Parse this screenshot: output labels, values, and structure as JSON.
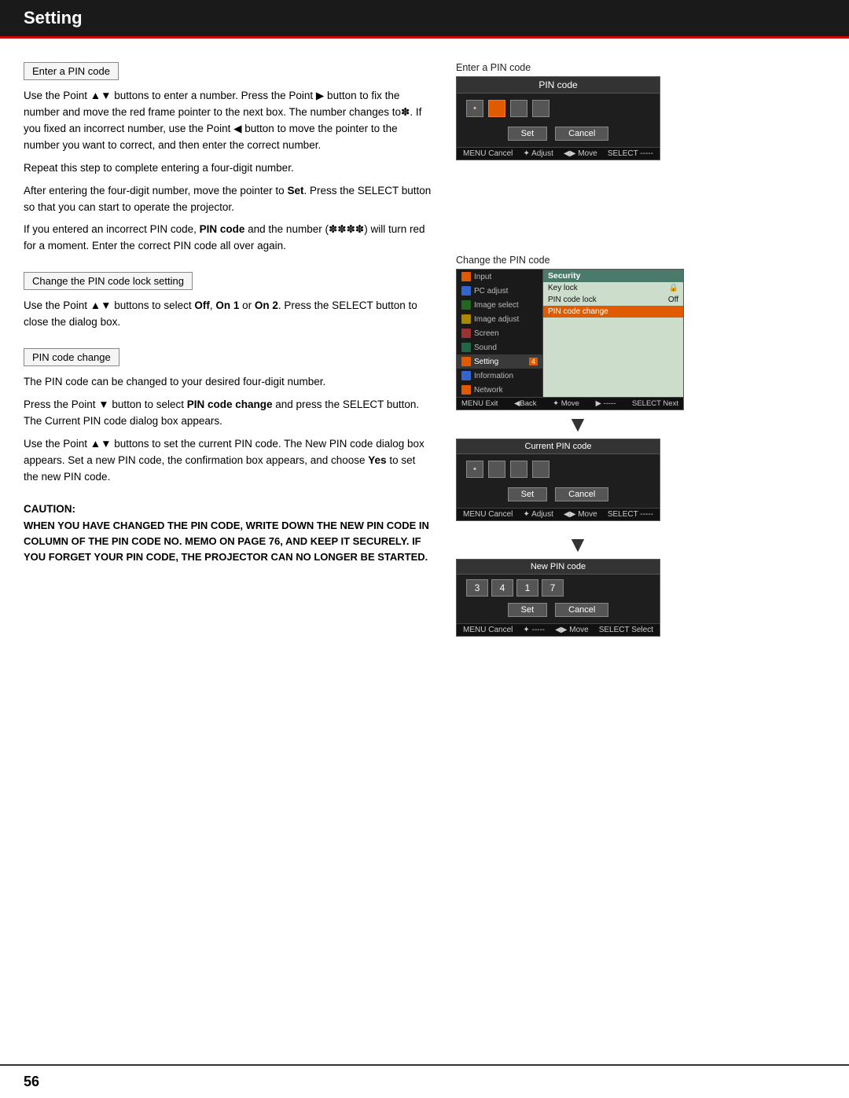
{
  "header": {
    "title": "Setting",
    "bg_color": "#1a1a1a",
    "accent_color": "#cc0000"
  },
  "page_number": "56",
  "sections": {
    "enter_pin": {
      "label": "Enter a PIN code",
      "paragraphs": [
        "Use the Point ▲▼ buttons to enter a number. Press the Point ▶ button to fix the number and move the red frame pointer to the next box. The number changes to✽. If you fixed an incorrect number, use the Point ◀ button to move the pointer to the number you want to correct, and then enter the correct number.",
        "Repeat this step to complete entering a four-digit number.",
        "After entering the four-digit number, move the pointer to Set. Press the SELECT button so that you can start to operate the projector.",
        "If you entered an incorrect PIN code, PIN code and the number (✽✽✽✽) will turn red for a moment. Enter the correct PIN code all over again."
      ]
    },
    "change_pin_lock": {
      "label": "Change the PIN code lock setting",
      "paragraphs": [
        "Use the Point ▲▼ buttons to select Off, On 1 or On 2. Press the SELECT button to close the dialog box."
      ]
    },
    "pin_code_change": {
      "label": "PIN code change",
      "paragraphs": [
        "The PIN code can be changed to your desired four-digit number.",
        "Press the Point ▼ button to select PIN code change and press the SELECT button. The Current PIN code dialog box appears.",
        "Use the Point ▲▼ buttons to set the current PIN code. The New PIN code dialog box appears. Set a new PIN code, the confirmation box appears, and choose Yes to set the new PIN code."
      ]
    },
    "caution": {
      "title": "CAUTION:",
      "text": "WHEN YOU HAVE CHANGED THE PIN CODE, WRITE DOWN THE NEW PIN CODE IN COLUMN OF THE PIN CODE NO. MEMO ON PAGE 76, AND KEEP IT SECURELY. IF YOU FORGET YOUR PIN CODE, THE PROJECTOR CAN NO LONGER BE STARTED."
    }
  },
  "diagrams": {
    "pin_code_dialog": {
      "label": "Enter a PIN code",
      "title": "PIN code",
      "dot_active_index": 1,
      "dots": [
        "•",
        " ",
        " ",
        " "
      ],
      "set_label": "Set",
      "cancel_label": "Cancel",
      "statusbar": {
        "left": "MENU Cancel",
        "center": "✦ Adjust",
        "right_move": "◀▶ Move",
        "right_select": "SELECT -----"
      }
    },
    "change_pin_label": "Change the PIN code",
    "security_menu": {
      "title": "Security",
      "left_items": [
        {
          "label": "Input",
          "icon_color": "orange"
        },
        {
          "label": "PC adjust",
          "icon_color": "blue"
        },
        {
          "label": "Image select",
          "icon_color": "green"
        },
        {
          "label": "Image adjust",
          "icon_color": "yellow"
        },
        {
          "label": "Screen",
          "icon_color": "red"
        },
        {
          "label": "Sound",
          "icon_color": "teal"
        },
        {
          "label": "Setting",
          "active": true,
          "number": "4"
        },
        {
          "label": "Information",
          "icon_color": "blue"
        },
        {
          "label": "Network",
          "icon_color": "orange"
        }
      ],
      "right_items": [
        {
          "label": "Key lock",
          "value": "🔒"
        },
        {
          "label": "PIN code lock",
          "value": "Off"
        },
        {
          "label": "PIN code change",
          "highlighted": true
        }
      ],
      "statusbar": {
        "left": "MENU Exit",
        "back": "◀Back",
        "center": "✦ Move",
        "right": "▶ -----",
        "select": "SELECT Next"
      }
    },
    "current_pin": {
      "title": "Current PIN code",
      "dot": "•",
      "set_label": "Set",
      "cancel_label": "Cancel",
      "statusbar": {
        "left": "MENU Cancel",
        "center": "✦ Adjust",
        "move": "◀▶ Move",
        "select": "SELECT -----"
      }
    },
    "new_pin": {
      "title": "New PIN code",
      "digits": [
        "3",
        "4",
        "1",
        "7"
      ],
      "set_label": "Set",
      "cancel_label": "Cancel",
      "statusbar": {
        "left": "MENU Cancel",
        "center": "✦ -----",
        "move": "◀▶ Move",
        "select": "SELECT Select"
      }
    }
  }
}
